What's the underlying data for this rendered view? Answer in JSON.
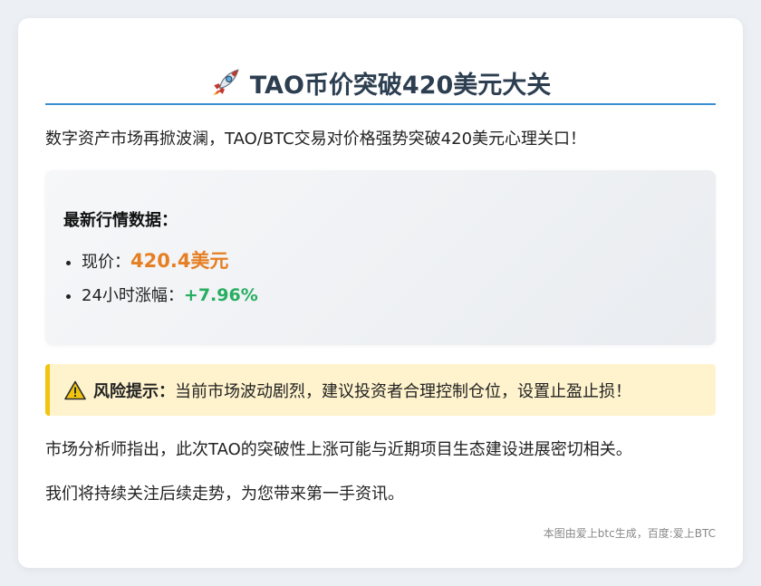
{
  "article": {
    "title_icon": "rocket-icon",
    "title": "TAO币价突破420美元大关",
    "intro": "数字资产市场再掀波澜，TAO/BTC交易对价格强势突破420美元心理关口！",
    "market": {
      "heading": "最新行情数据：",
      "price_label": "现价：",
      "price_value": "420.4美元",
      "change_label": "24小时涨幅：",
      "change_value": "+7.96%"
    },
    "risk": {
      "icon": "warning-icon",
      "label": "风险提示：",
      "text": "当前市场波动剧烈，建议投资者合理控制仓位，设置止盈止损！"
    },
    "paragraph1": "市场分析师指出，此次TAO的突破性上涨可能与近期项目生态建设进展密切相关。",
    "paragraph2": "我们将持续关注后续走势，为您带来第一手资讯。",
    "footer": "本图由爱上btc生成，百度:爱上BTC"
  },
  "colors": {
    "title": "#2c3e50",
    "title_rule": "#3a8fd0",
    "price": "#e67e22",
    "change": "#27ae60",
    "risk_bg": "#fff3cd",
    "risk_border": "#f1c40f"
  }
}
